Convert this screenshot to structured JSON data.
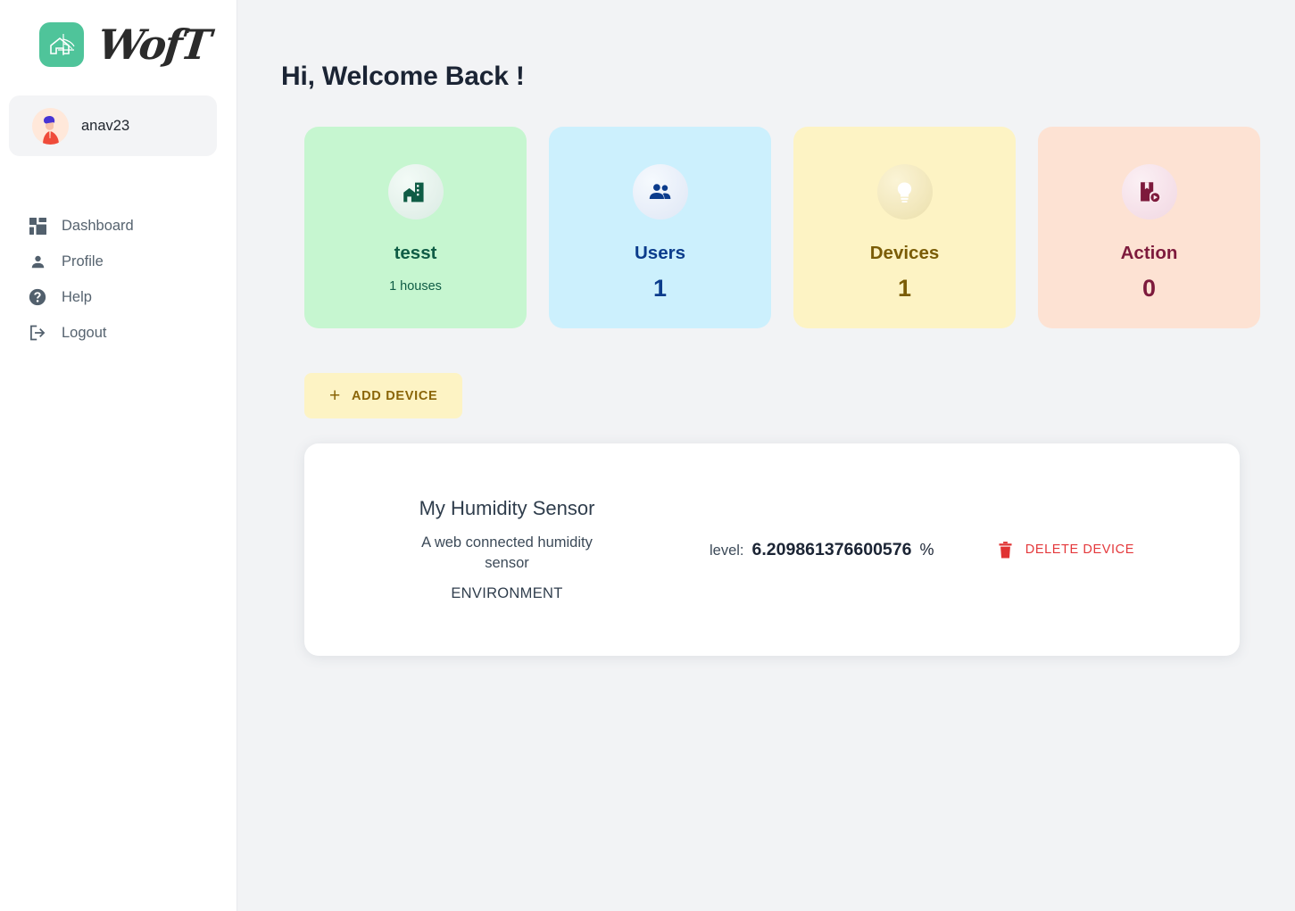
{
  "brand": {
    "wordmark": "WofT",
    "mark_color": "#4fc49a",
    "mark_icon": "house-wifi-icon"
  },
  "sidebar": {
    "user": {
      "name": "anav23",
      "avatar_icon": "user-avatar"
    },
    "items": [
      {
        "label": "Dashboard",
        "icon": "dashboard-grid-icon"
      },
      {
        "label": "Profile",
        "icon": "person-icon"
      },
      {
        "label": "Help",
        "icon": "help-circle-icon"
      },
      {
        "label": "Logout",
        "icon": "logout-icon"
      }
    ]
  },
  "main": {
    "greeting": "Hi, Welcome Back !",
    "stats": [
      {
        "label": "tesst",
        "sub": "1 houses",
        "value": "",
        "icon": "home-work-icon",
        "bg": "#c6f6d0",
        "fg": "#0f5c45"
      },
      {
        "label": "Users",
        "sub": "",
        "value": "1",
        "icon": "groups-icon",
        "bg": "#ccf0fd",
        "fg": "#0b3c8c"
      },
      {
        "label": "Devices",
        "sub": "",
        "value": "1",
        "icon": "lightbulb-icon",
        "bg": "#fdf3c4",
        "fg": "#7a5c06"
      },
      {
        "label": "Action",
        "sub": "",
        "value": "0",
        "icon": "book-play-icon",
        "bg": "#fde2d3",
        "fg": "#7d1a3c"
      }
    ],
    "add_device": {
      "label": "ADD DEVICE",
      "plus": "+"
    },
    "device": {
      "title": "My Humidity Sensor",
      "description": "A web connected humidity sensor",
      "type": "ENVIRONMENT",
      "reading_label": "level:",
      "reading_value": "6.209861376600576",
      "reading_unit": "%",
      "delete_label": "DELETE DEVICE",
      "delete_icon": "trash-icon",
      "delete_color": "#e4383b"
    }
  }
}
